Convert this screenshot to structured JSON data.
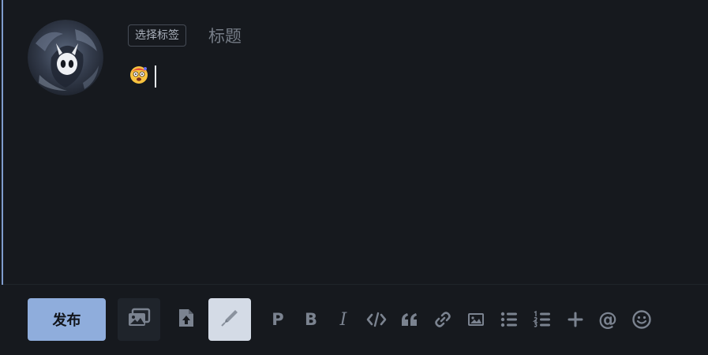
{
  "header": {
    "tag_button_label": "选择标签",
    "title_placeholder": "标题"
  },
  "content": {
    "emoji": "😵‍💫"
  },
  "toolbar": {
    "publish_label": "发布",
    "paragraph_label": "P",
    "bold_label": "B",
    "italic_label": "I",
    "buttons": [
      "image-gallery-icon",
      "file-upload-icon",
      "pen-icon"
    ],
    "tools": [
      "code-icon",
      "quote-icon",
      "link-icon",
      "image-icon",
      "bullet-list-icon",
      "numbered-list-icon",
      "plus-icon",
      "mention-icon",
      "emoji-icon"
    ],
    "mention_label": "@"
  },
  "colors": {
    "background": "#16191e",
    "accent": "#8faddc",
    "icon": "#7b8390",
    "active_button_bg": "#d4dbe6"
  }
}
